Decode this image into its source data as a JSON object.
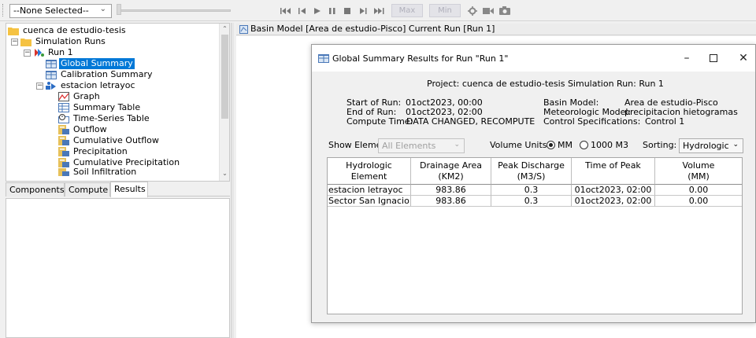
{
  "toolbar": {
    "element_select": "--None Selected--",
    "buttons": [
      "rewind-to-start",
      "step-back",
      "play",
      "pause",
      "stop",
      "step-forward",
      "fast-forward"
    ],
    "max_label": "Max",
    "min_label": "Min"
  },
  "tree": {
    "items": [
      {
        "label": "cuenca de estudio-tesis",
        "icon": "folder-icon"
      },
      {
        "label": "Simulation Runs",
        "icon": "folder-icon"
      },
      {
        "label": "Run 1",
        "icon": "run-icon"
      },
      {
        "label": "Global Summary",
        "icon": "summary-icon",
        "selected": true
      },
      {
        "label": "Calibration Summary",
        "icon": "summary-icon"
      },
      {
        "label": "estacion letrayoc",
        "icon": "station-icon"
      },
      {
        "label": "Graph",
        "icon": "graph-icon"
      },
      {
        "label": "Summary Table",
        "icon": "table-icon"
      },
      {
        "label": "Time-Series Table",
        "icon": "timeseries-icon"
      },
      {
        "label": "Outflow",
        "icon": "series-icon"
      },
      {
        "label": "Cumulative Outflow",
        "icon": "series-icon"
      },
      {
        "label": "Precipitation",
        "icon": "series-icon"
      },
      {
        "label": "Cumulative Precipitation",
        "icon": "series-icon"
      },
      {
        "label": "Soil Infiltration",
        "icon": "series-icon"
      }
    ]
  },
  "tabs": [
    "Components",
    "Compute",
    "Results"
  ],
  "active_tab": "Results",
  "basin_window": {
    "title": "Basin Model [Area de estudio-Pisco] Current Run [Run 1]"
  },
  "dialog": {
    "title": "Global Summary Results for Run \"Run 1\"",
    "project_line": "Project: cuenca de estudio-tesis    Simulation Run: Run 1",
    "start_label": "Start of Run:",
    "start_value": "01oct2023, 00:00",
    "end_label": "End of Run:",
    "end_value": "01oct2023, 02:00",
    "compute_label": "Compute Time:",
    "compute_value": "DATA CHANGED, RECOMPUTE",
    "basin_label": "Basin Model:",
    "basin_value": "Area de estudio-Pisco",
    "met_label": "Meteorologic Model:",
    "met_value": "precipitacion hietogramas",
    "control_label": "Control Specifications:",
    "control_value": "Control 1",
    "show_label": "Show Elements:",
    "show_value": "All Elements",
    "volume_label": "Volume Units:",
    "vol_opt1": "MM",
    "vol_opt2": "1000 M3",
    "sorting_label": "Sorting:",
    "sorting_value": "Hydrologic"
  },
  "table": {
    "headers": [
      [
        "Hydrologic",
        "Element"
      ],
      [
        "Drainage Area",
        "(KM2)"
      ],
      [
        "Peak Discharge",
        "(M3/S)"
      ],
      [
        "Time of Peak",
        ""
      ],
      [
        "Volume",
        "(MM)"
      ]
    ],
    "rows": [
      [
        "estacion letrayoc",
        "983.86",
        "0.3",
        "01oct2023, 02:00",
        "0.00"
      ],
      [
        "Sector San Ignacio II",
        "983.86",
        "0.3",
        "01oct2023, 02:00",
        "0.00"
      ]
    ]
  },
  "colors": {
    "selection": "#0078d7",
    "folder": "#f5c242"
  }
}
